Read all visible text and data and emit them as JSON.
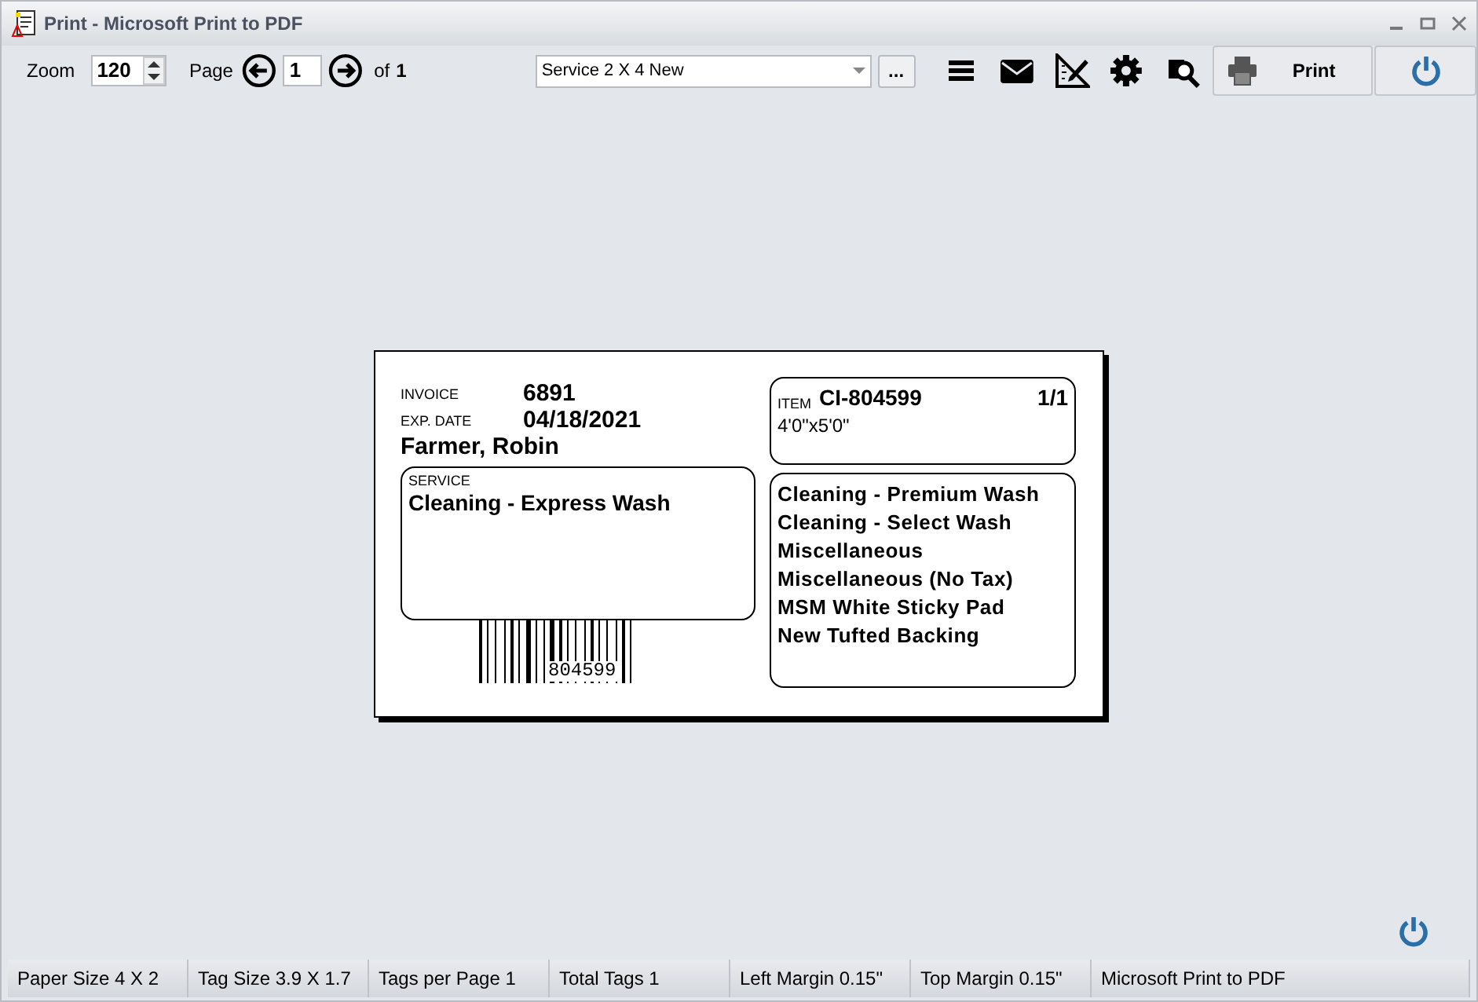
{
  "window": {
    "title": "Print - Microsoft Print to PDF"
  },
  "toolbar": {
    "zoom_label": "Zoom",
    "zoom_value": "120",
    "page_label": "Page",
    "page_value": "1",
    "of_label": "of",
    "page_count": "1",
    "template": "Service 2 X 4 New",
    "more_button": "...",
    "print_button": "Print"
  },
  "label": {
    "invoice_label": "INVOICE",
    "invoice": "6891",
    "exp_label": "EXP. DATE",
    "exp_date": "04/18/2021",
    "customer": "Farmer, Robin",
    "service_label": "SERVICE",
    "service": "Cleaning - Express Wash",
    "barcode_number": "804599",
    "item_label": "ITEM",
    "item": "CI-804599",
    "item_count": "1/1",
    "size": "4'0\"x5'0\"",
    "services": [
      "Cleaning - Premium Wash",
      "Cleaning - Select Wash",
      "Miscellaneous",
      "Miscellaneous (No Tax)",
      "MSM White Sticky Pad",
      "New Tufted Backing"
    ]
  },
  "status_bar": [
    "Paper Size 4 X 2",
    "Tag Size 3.9 X 1.7",
    "Tags per Page 1",
    "Total Tags 1",
    "Left Margin 0.15\"",
    "Top Margin 0.15\"",
    "Microsoft Print to PDF"
  ]
}
